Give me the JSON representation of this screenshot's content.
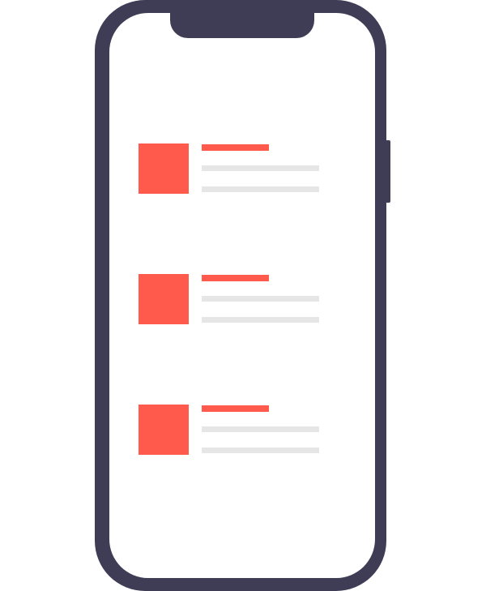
{
  "colors": {
    "frame": "#3f3d56",
    "screen": "#ffffff",
    "accent": "#ff5a4c",
    "placeholder_line": "#e6e6e6",
    "background": "#ffffff"
  },
  "list": {
    "items": [
      {
        "thumbnail": "image-placeholder",
        "title": "",
        "line1": "",
        "line2": ""
      },
      {
        "thumbnail": "image-placeholder",
        "title": "",
        "line1": "",
        "line2": ""
      },
      {
        "thumbnail": "image-placeholder",
        "title": "",
        "line1": "",
        "line2": ""
      }
    ]
  }
}
